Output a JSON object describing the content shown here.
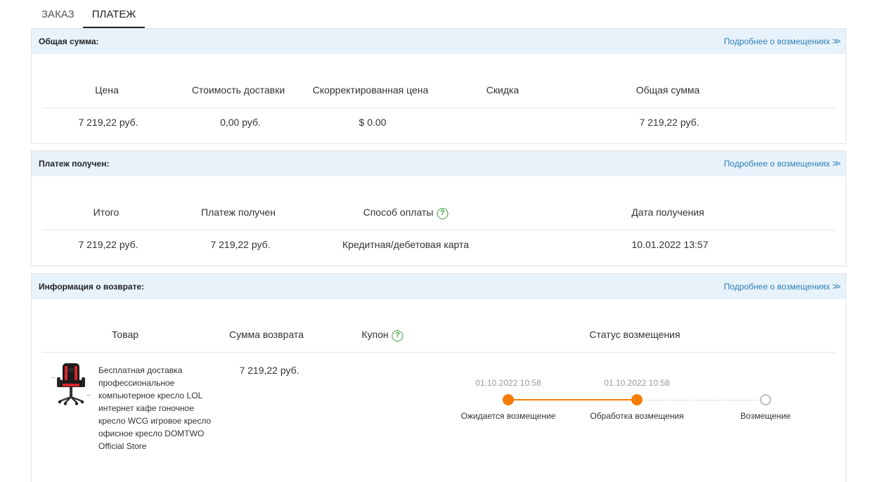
{
  "tabs": [
    {
      "label": "ЗАКАЗ",
      "active": false
    },
    {
      "label": "ПЛАТЕЖ",
      "active": true
    }
  ],
  "details_link": "Подробнее о возмещениях",
  "total": {
    "title": "Общая сумма:",
    "headers": [
      "Цена",
      "Стоимость доставки",
      "Скорректированная цена",
      "Скидка",
      "Общая сумма"
    ],
    "values": [
      "7 219,22 руб.",
      "0,00 руб.",
      "$ 0.00",
      "",
      "7 219,22 руб."
    ]
  },
  "payment": {
    "title": "Платеж получен:",
    "headers": [
      "Итого",
      "Платеж получен",
      "Способ оплаты",
      "Дата получения"
    ],
    "values": [
      "7 219,22 руб.",
      "7 219,22 руб.",
      "Кредитная/дебетовая карта",
      "10.01.2022 13:57"
    ]
  },
  "refund": {
    "title": "Информация о возврате:",
    "headers": [
      "Товар",
      "Сумма возврата",
      "Купон",
      "Статус возмещения"
    ],
    "product_name": "Бесплатная доставка профессиональное компьютерное кресло LOL интернет кафе гоночное кресло WCG игровое кресло офисное кресло DOMTWO Official Store",
    "amount": "7 219,22 руб.",
    "timeline": [
      {
        "label": "Ожидается возмещение",
        "date": "01.10.2022 10:58",
        "done": true
      },
      {
        "label": "Обработка возмещения",
        "date": "01.10.2022 10:58",
        "done": true
      },
      {
        "label": "Возмещение",
        "date": "",
        "done": false
      }
    ]
  },
  "colors": {
    "accent": "#f47d06",
    "link": "#2d7fb6",
    "header_bg": "#e8f2fb",
    "help_icon": "#3a9e3a"
  }
}
